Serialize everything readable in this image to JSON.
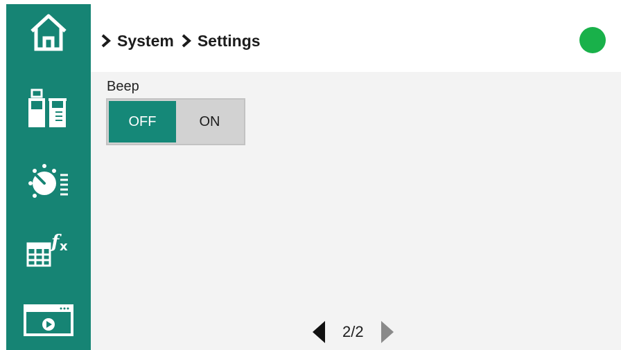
{
  "breadcrumb": [
    "System",
    "Settings"
  ],
  "status": {
    "color": "#19b14a"
  },
  "beep": {
    "label": "Beep",
    "options": [
      "OFF",
      "ON"
    ],
    "selected": "OFF",
    "active_color": "#158878",
    "inactive_color": "#d2d2d2"
  },
  "pagination": {
    "text": "2/2"
  },
  "sidebar": {
    "color": "#168474",
    "items": [
      {
        "icon": "home-icon"
      },
      {
        "icon": "bottle-beaker-icon"
      },
      {
        "icon": "timer-dial-icon"
      },
      {
        "icon": "table-function-icon"
      },
      {
        "icon": "video-player-icon"
      }
    ]
  }
}
